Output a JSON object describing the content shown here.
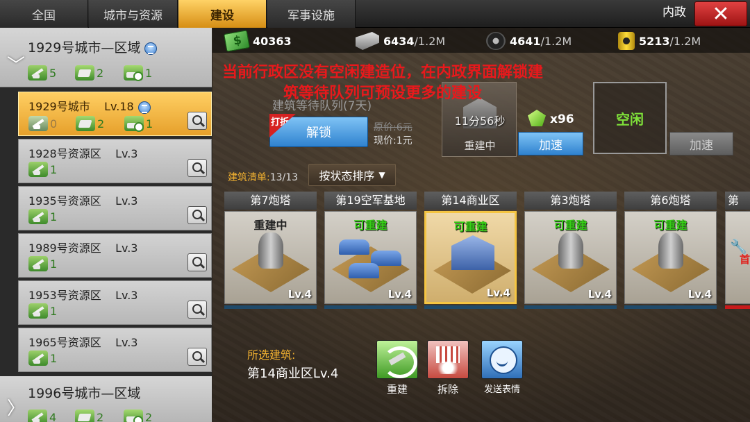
{
  "tabs": [
    {
      "label": "全国",
      "active": false
    },
    {
      "label": "城市与资源",
      "active": false
    },
    {
      "label": "建设",
      "active": true
    },
    {
      "label": "军事设施",
      "active": false
    }
  ],
  "header": {
    "right_label": "内政",
    "close_icon": "close-icon"
  },
  "colors": {
    "accent": "#e6a02b",
    "alert": "#e8191c",
    "ok": "#36d016"
  },
  "regions": [
    {
      "title": "1929号城市—区域",
      "expanded": true,
      "stats": {
        "build": "5",
        "resource": "2",
        "military": "1"
      }
    },
    {
      "title": "1996号城市—区域",
      "expanded": false,
      "stats": {
        "build": "4",
        "resource": "2",
        "military": "2"
      }
    }
  ],
  "cities": [
    {
      "name": "1929号城市    Lv.18",
      "selected": true,
      "has_gov_icon": true,
      "stats": {
        "build": "0",
        "resource": "2",
        "military": "1"
      }
    },
    {
      "name": "1928号资源区    Lv.3",
      "selected": false,
      "stats": {
        "build": "1"
      }
    },
    {
      "name": "1935号资源区    Lv.3",
      "selected": false,
      "stats": {
        "build": "1"
      }
    },
    {
      "name": "1989号资源区    Lv.3",
      "selected": false,
      "stats": {
        "build": "1"
      }
    },
    {
      "name": "1953号资源区    Lv.3",
      "selected": false,
      "stats": {
        "build": "1"
      }
    },
    {
      "name": "1965号资源区    Lv.3",
      "selected": false,
      "stats": {
        "build": "1"
      }
    }
  ],
  "resources": [
    {
      "name": "money",
      "icon": "money-icon",
      "current": "40363",
      "max": ""
    },
    {
      "name": "steel",
      "icon": "steel-icon",
      "current": "6434",
      "max": "/1.2M"
    },
    {
      "name": "rubber",
      "icon": "tire-icon",
      "current": "4641",
      "max": "/1.2M"
    },
    {
      "name": "oil",
      "icon": "oil-icon",
      "current": "5213",
      "max": "/1.2M"
    }
  ],
  "notice": "当前行政区没有空闲建造位，在内政界面解锁建筑等待队列可预设更多的建设",
  "queue": {
    "title": "建筑等待队列(7天)",
    "discount_badge": "打折",
    "unlock_label": "解锁",
    "price_original": "原价:6元",
    "price_current": "现价:1元"
  },
  "building_slot": {
    "timer": "11分56秒",
    "status": "重建中",
    "gems": "x96",
    "speedup_label": "加速"
  },
  "idle_slot": {
    "label": "空闲",
    "speedup_label": "加速"
  },
  "build_list": {
    "label": "建筑清单:",
    "count": "13/13",
    "sort_label": "按状态排序"
  },
  "buildings": [
    {
      "name": "第7炮塔",
      "state": "重建中",
      "state_type": "busy",
      "level": "Lv.4",
      "kind": "tower"
    },
    {
      "name": "第19空军基地",
      "state": "可重建",
      "state_type": "ok",
      "level": "Lv.4",
      "kind": "airbase"
    },
    {
      "name": "第14商业区",
      "state": "可重建",
      "state_type": "ok",
      "level": "Lv.4",
      "kind": "commerce",
      "selected": true
    },
    {
      "name": "第3炮塔",
      "state": "可重建",
      "state_type": "ok",
      "level": "Lv.4",
      "kind": "tower"
    },
    {
      "name": "第6炮塔",
      "state": "可重建",
      "state_type": "ok",
      "level": "Lv.4",
      "kind": "tower"
    },
    {
      "name": "第",
      "state": "首",
      "state_type": "alert",
      "level": "",
      "kind": "partial"
    }
  ],
  "selected": {
    "label": "所选建筑:",
    "name": "第14商业区Lv.4"
  },
  "actions": [
    {
      "label": "重建",
      "icon": "rebuild-icon"
    },
    {
      "label": "拆除",
      "icon": "demolish-icon"
    },
    {
      "label": "发送表情",
      "icon": "emote-icon"
    }
  ]
}
